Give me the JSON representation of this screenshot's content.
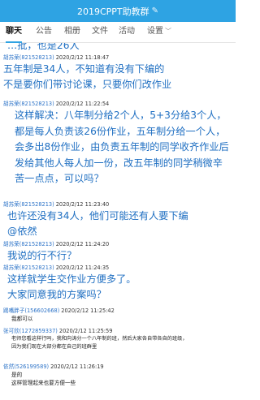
{
  "window": {
    "title": "2019CPPT助教群",
    "edit_icon": "edit-icon"
  },
  "tabs": [
    {
      "label": "聊天"
    },
    {
      "label": "公告"
    },
    {
      "label": "相册"
    },
    {
      "label": "文件"
    },
    {
      "label": "活动"
    },
    {
      "label": "设置"
    }
  ],
  "messages": [
    {
      "lines": [
        "…批，也是26人"
      ]
    },
    {
      "name": "胡苏荣",
      "id": "(821528213)",
      "time": "2020/2/12 11:18:47",
      "lines": [
        "五年制是34人，不知道有没有下编的",
        "不是要你们带讨论课，只要你们改作业"
      ]
    },
    {
      "name": "胡苏荣",
      "id": "(821528213)",
      "time": "2020/2/12 11:22:54",
      "text": "这样解决：八年制分给2个人，5+3分给3个人，都是每人负责该26份作业，五年制分给一个人，会多出8份作业，由负责五年制的同学收齐作业后发给其他人每人加一份，改五年制的同学稍微辛苦一点点，可以吗？"
    },
    {
      "name": "胡苏荣",
      "id": "(821528213)",
      "time": "2020/2/12 11:23:40",
      "lines": [
        "也许还没有34人，他们可能还有人要下编",
        "@依然"
      ]
    },
    {
      "name": "胡苏荣",
      "id": "(821528213)",
      "time": "2020/2/12 11:24:20",
      "lines": [
        "我说的行不行？"
      ]
    },
    {
      "name": "胡苏荣",
      "id": "(821528213)",
      "time": "2020/2/12 11:24:35",
      "lines": [
        "这样就学生交作业方便多了。",
        "大家同意我的方案吗？"
      ]
    },
    {
      "name": "踢嘴胖子",
      "id": "(156602668)",
      "time": "2020/2/12 11:25:42",
      "small": [
        "我都可以"
      ]
    },
    {
      "name": "张可欣",
      "id": "(1272859337)",
      "time": "2020/2/12 11:25:59",
      "small": [
        "老师您看这样行吗，我和向涛分一个八年制的班，然后大家各自带各自的班级，",
        "因为我们现在大部分都在自己的班群里"
      ]
    },
    {
      "name": "依然",
      "id": "(526199589)",
      "time": "2020/2/12 11:26:19",
      "small": [
        "是的",
        "这样管理起来也要方便一些"
      ]
    }
  ]
}
